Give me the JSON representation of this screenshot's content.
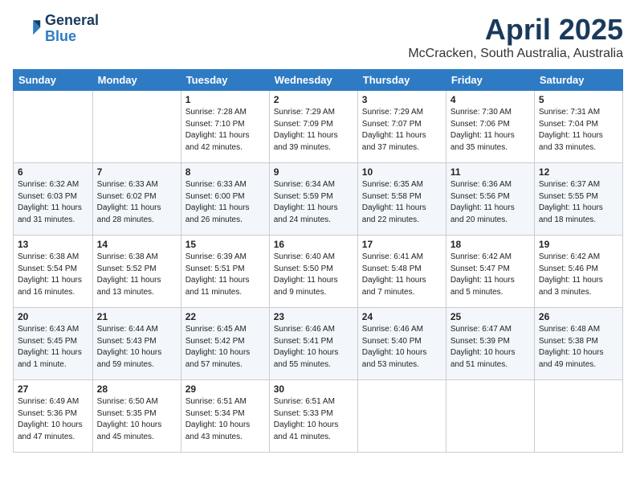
{
  "header": {
    "logo_line1": "General",
    "logo_line2": "Blue",
    "month": "April 2025",
    "location": "McCracken, South Australia, Australia"
  },
  "weekdays": [
    "Sunday",
    "Monday",
    "Tuesday",
    "Wednesday",
    "Thursday",
    "Friday",
    "Saturday"
  ],
  "weeks": [
    [
      {
        "day": "",
        "info": ""
      },
      {
        "day": "",
        "info": ""
      },
      {
        "day": "1",
        "info": "Sunrise: 7:28 AM\nSunset: 7:10 PM\nDaylight: 11 hours and 42 minutes."
      },
      {
        "day": "2",
        "info": "Sunrise: 7:29 AM\nSunset: 7:09 PM\nDaylight: 11 hours and 39 minutes."
      },
      {
        "day": "3",
        "info": "Sunrise: 7:29 AM\nSunset: 7:07 PM\nDaylight: 11 hours and 37 minutes."
      },
      {
        "day": "4",
        "info": "Sunrise: 7:30 AM\nSunset: 7:06 PM\nDaylight: 11 hours and 35 minutes."
      },
      {
        "day": "5",
        "info": "Sunrise: 7:31 AM\nSunset: 7:04 PM\nDaylight: 11 hours and 33 minutes."
      }
    ],
    [
      {
        "day": "6",
        "info": "Sunrise: 6:32 AM\nSunset: 6:03 PM\nDaylight: 11 hours and 31 minutes."
      },
      {
        "day": "7",
        "info": "Sunrise: 6:33 AM\nSunset: 6:02 PM\nDaylight: 11 hours and 28 minutes."
      },
      {
        "day": "8",
        "info": "Sunrise: 6:33 AM\nSunset: 6:00 PM\nDaylight: 11 hours and 26 minutes."
      },
      {
        "day": "9",
        "info": "Sunrise: 6:34 AM\nSunset: 5:59 PM\nDaylight: 11 hours and 24 minutes."
      },
      {
        "day": "10",
        "info": "Sunrise: 6:35 AM\nSunset: 5:58 PM\nDaylight: 11 hours and 22 minutes."
      },
      {
        "day": "11",
        "info": "Sunrise: 6:36 AM\nSunset: 5:56 PM\nDaylight: 11 hours and 20 minutes."
      },
      {
        "day": "12",
        "info": "Sunrise: 6:37 AM\nSunset: 5:55 PM\nDaylight: 11 hours and 18 minutes."
      }
    ],
    [
      {
        "day": "13",
        "info": "Sunrise: 6:38 AM\nSunset: 5:54 PM\nDaylight: 11 hours and 16 minutes."
      },
      {
        "day": "14",
        "info": "Sunrise: 6:38 AM\nSunset: 5:52 PM\nDaylight: 11 hours and 13 minutes."
      },
      {
        "day": "15",
        "info": "Sunrise: 6:39 AM\nSunset: 5:51 PM\nDaylight: 11 hours and 11 minutes."
      },
      {
        "day": "16",
        "info": "Sunrise: 6:40 AM\nSunset: 5:50 PM\nDaylight: 11 hours and 9 minutes."
      },
      {
        "day": "17",
        "info": "Sunrise: 6:41 AM\nSunset: 5:48 PM\nDaylight: 11 hours and 7 minutes."
      },
      {
        "day": "18",
        "info": "Sunrise: 6:42 AM\nSunset: 5:47 PM\nDaylight: 11 hours and 5 minutes."
      },
      {
        "day": "19",
        "info": "Sunrise: 6:42 AM\nSunset: 5:46 PM\nDaylight: 11 hours and 3 minutes."
      }
    ],
    [
      {
        "day": "20",
        "info": "Sunrise: 6:43 AM\nSunset: 5:45 PM\nDaylight: 11 hours and 1 minute."
      },
      {
        "day": "21",
        "info": "Sunrise: 6:44 AM\nSunset: 5:43 PM\nDaylight: 10 hours and 59 minutes."
      },
      {
        "day": "22",
        "info": "Sunrise: 6:45 AM\nSunset: 5:42 PM\nDaylight: 10 hours and 57 minutes."
      },
      {
        "day": "23",
        "info": "Sunrise: 6:46 AM\nSunset: 5:41 PM\nDaylight: 10 hours and 55 minutes."
      },
      {
        "day": "24",
        "info": "Sunrise: 6:46 AM\nSunset: 5:40 PM\nDaylight: 10 hours and 53 minutes."
      },
      {
        "day": "25",
        "info": "Sunrise: 6:47 AM\nSunset: 5:39 PM\nDaylight: 10 hours and 51 minutes."
      },
      {
        "day": "26",
        "info": "Sunrise: 6:48 AM\nSunset: 5:38 PM\nDaylight: 10 hours and 49 minutes."
      }
    ],
    [
      {
        "day": "27",
        "info": "Sunrise: 6:49 AM\nSunset: 5:36 PM\nDaylight: 10 hours and 47 minutes."
      },
      {
        "day": "28",
        "info": "Sunrise: 6:50 AM\nSunset: 5:35 PM\nDaylight: 10 hours and 45 minutes."
      },
      {
        "day": "29",
        "info": "Sunrise: 6:51 AM\nSunset: 5:34 PM\nDaylight: 10 hours and 43 minutes."
      },
      {
        "day": "30",
        "info": "Sunrise: 6:51 AM\nSunset: 5:33 PM\nDaylight: 10 hours and 41 minutes."
      },
      {
        "day": "",
        "info": ""
      },
      {
        "day": "",
        "info": ""
      },
      {
        "day": "",
        "info": ""
      }
    ]
  ]
}
